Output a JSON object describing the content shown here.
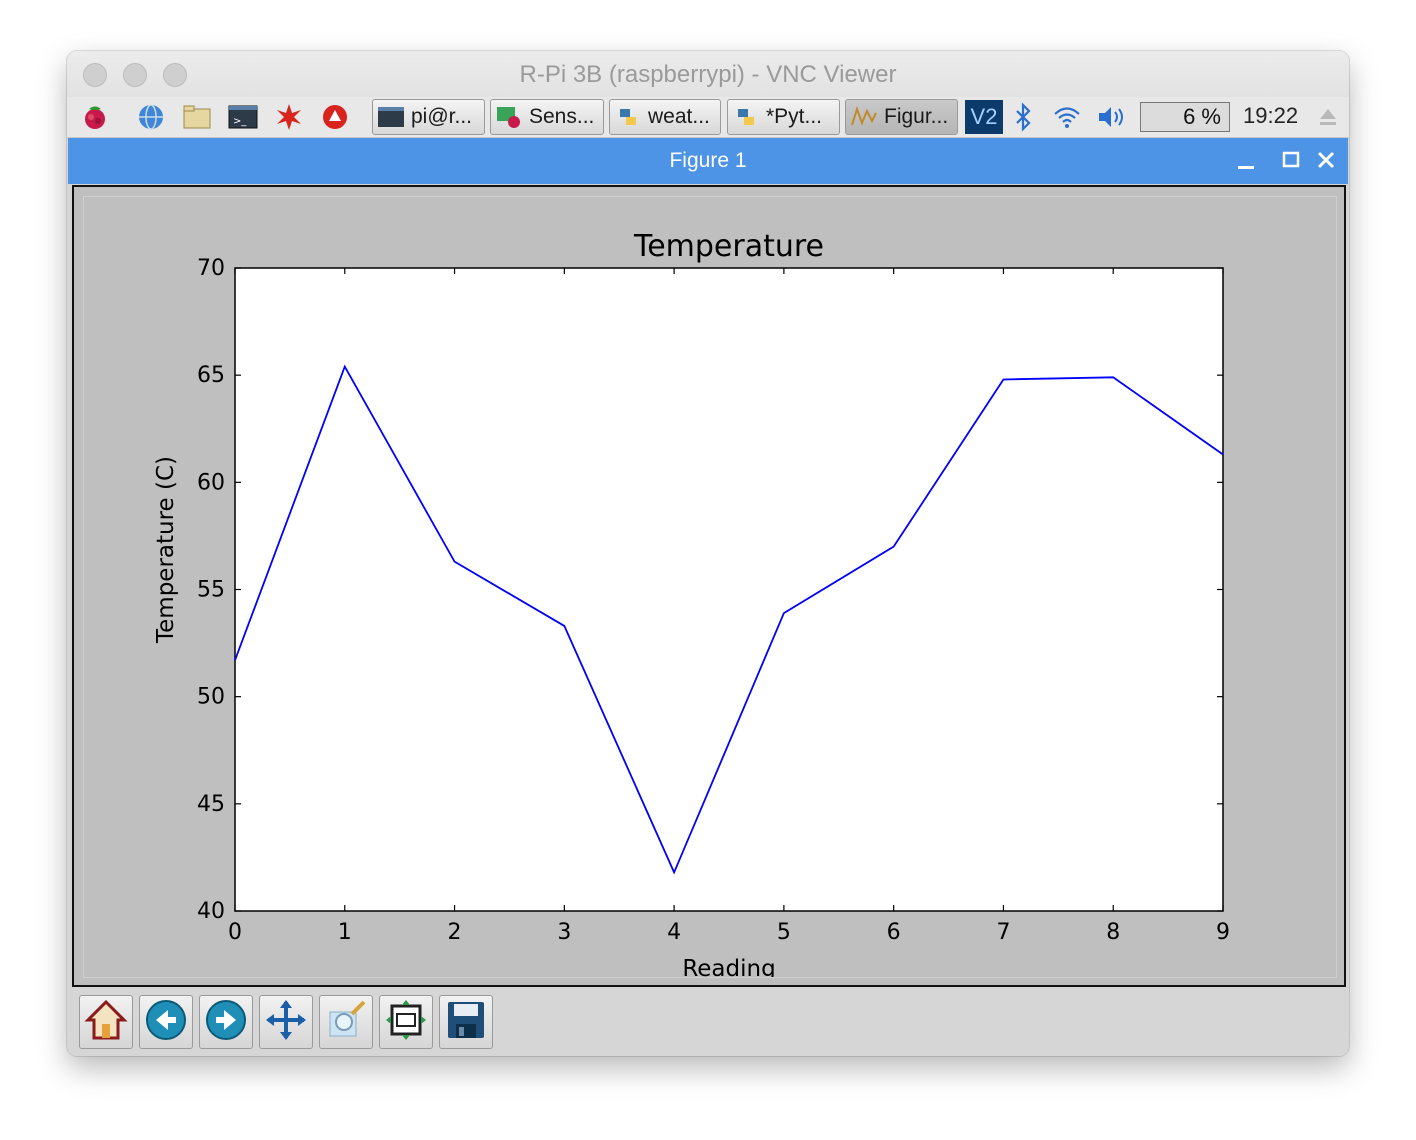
{
  "vnc_window": {
    "title": "R-Pi 3B (raspberrypi) - VNC Viewer"
  },
  "taskbar": {
    "launchers": [
      {
        "icon": "raspberry-menu-icon"
      },
      {
        "icon": "web-browser-globe-icon"
      },
      {
        "icon": "file-manager-folder-icon"
      },
      {
        "icon": "terminal-icon"
      },
      {
        "icon": "mathematica-star-icon"
      },
      {
        "icon": "wolfram-icon"
      }
    ],
    "tasks": [
      {
        "label": "pi@r...",
        "icon": "terminal-icon"
      },
      {
        "label": "Sens...",
        "icon": "sense-hat-icon"
      },
      {
        "label": "weat...",
        "icon": "python-icon"
      },
      {
        "label": "*Pyt...",
        "icon": "python-icon"
      },
      {
        "label": "Figur...",
        "icon": "figure-icon"
      }
    ],
    "tray": {
      "vnc_label": "V2",
      "cpu_percent": "6  %",
      "clock": "19:22"
    }
  },
  "figure_window": {
    "title": "Figure 1"
  },
  "chart_data": {
    "type": "line",
    "title": "Temperature",
    "xlabel": "Reading",
    "ylabel": "Temperature (C)",
    "x": [
      0,
      1,
      2,
      3,
      4,
      5,
      6,
      7,
      8,
      9
    ],
    "xlim": [
      0,
      9
    ],
    "ylim": [
      40,
      70
    ],
    "xticks": [
      "0",
      "1",
      "2",
      "3",
      "4",
      "5",
      "6",
      "7",
      "8",
      "9"
    ],
    "yticks": [
      "40",
      "45",
      "50",
      "55",
      "60",
      "65",
      "70"
    ],
    "series": [
      {
        "values": [
          51.7,
          65.4,
          56.3,
          53.3,
          41.8,
          53.9,
          57.0,
          64.8,
          64.9,
          61.3
        ],
        "color": "#0000ff"
      }
    ],
    "grid": false,
    "legend": "none"
  },
  "nav_toolbar": {
    "buttons": [
      {
        "icon": "home-icon"
      },
      {
        "icon": "back-arrow-icon"
      },
      {
        "icon": "forward-arrow-icon"
      },
      {
        "icon": "pan-move-icon"
      },
      {
        "icon": "zoom-rectangle-icon"
      },
      {
        "icon": "configure-subplots-icon"
      },
      {
        "icon": "save-floppy-icon"
      }
    ]
  }
}
